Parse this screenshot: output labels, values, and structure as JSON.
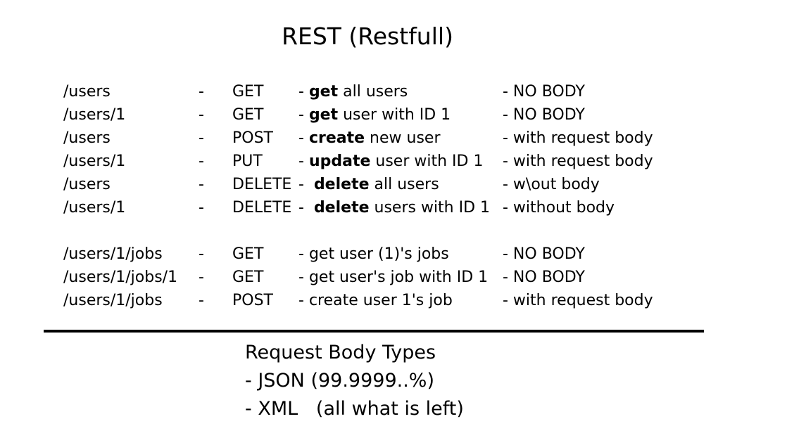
{
  "title": "REST (Restfull)",
  "routes": [
    {
      "path": "/users",
      "sep": "-",
      "method": "GET",
      "desc_prefix": "- ",
      "desc_verb": "get",
      "desc_rest": " all users",
      "body": "- NO BODY"
    },
    {
      "path": "/users/1",
      "sep": "-",
      "method": "GET",
      "desc_prefix": "- ",
      "desc_verb": "get",
      "desc_rest": " user with ID 1",
      "body": "- NO BODY"
    },
    {
      "path": "/users",
      "sep": "-",
      "method": "POST",
      "desc_prefix": "- ",
      "desc_verb": "create",
      "desc_rest": " new user",
      "body": "- with request body"
    },
    {
      "path": "/users/1",
      "sep": "-",
      "method": "PUT",
      "desc_prefix": "- ",
      "desc_verb": "update",
      "desc_rest": " user with ID 1",
      "body": "- with request body"
    },
    {
      "path": "/users",
      "sep": "-",
      "method": "DELETE",
      "desc_prefix": "-  ",
      "desc_verb": "delete",
      "desc_rest": " all users",
      "body": "- w\\out body"
    },
    {
      "path": "/users/1",
      "sep": "-",
      "method": "DELETE",
      "desc_prefix": "-  ",
      "desc_verb": "delete",
      "desc_rest": " users with ID 1",
      "body": "- without body"
    },
    {
      "path": "/users/1/jobs",
      "sep": "-",
      "method": "GET",
      "desc_prefix": "- ",
      "desc_verb": "",
      "desc_rest": "get user (1)'s jobs",
      "body": "- NO BODY"
    },
    {
      "path": "/users/1/jobs/1",
      "sep": "-",
      "method": "GET",
      "desc_prefix": "- ",
      "desc_verb": "",
      "desc_rest": "get user's job with ID 1",
      "body": "- NO BODY"
    },
    {
      "path": "/users/1/jobs",
      "sep": "-",
      "method": "POST",
      "desc_prefix": "- ",
      "desc_verb": "",
      "desc_rest": "create user 1's job",
      "body": "- with request body"
    }
  ],
  "body_types": {
    "heading": "Request Body Types",
    "items": [
      "- JSON (99.9999..%)",
      "- XML   (all what is left)"
    ]
  }
}
